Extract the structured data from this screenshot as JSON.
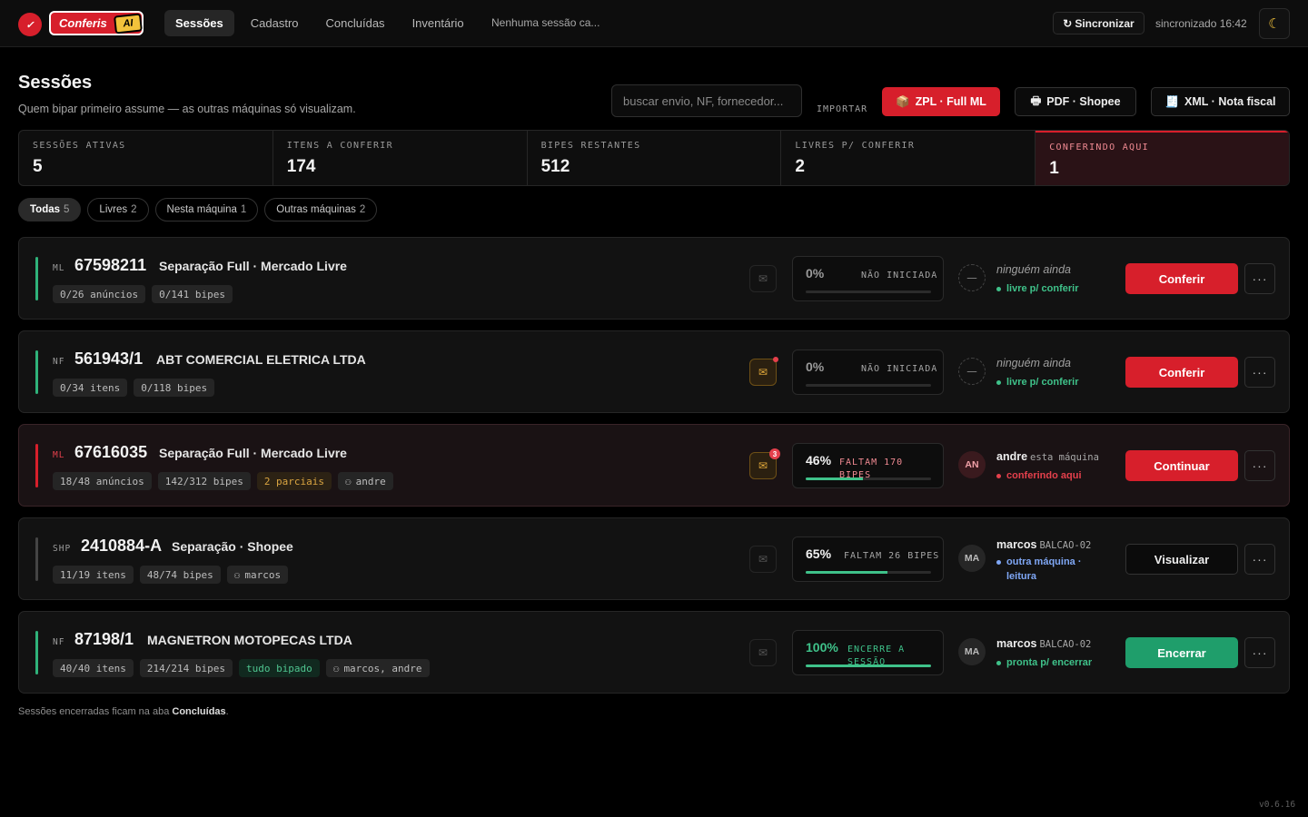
{
  "app": {
    "logo_text": "Conferis",
    "logo_badge": "AI",
    "version": "v0.6.16"
  },
  "nav": {
    "tabs": [
      "Sessões",
      "Cadastro",
      "Concluídas",
      "Inventário"
    ],
    "active": "Sessões",
    "session_status": "Nenhuma sessão ca..."
  },
  "sync": {
    "button_label": "Sincronizar",
    "status": "sincronizado 16:42"
  },
  "header": {
    "title": "Sessões",
    "subtitle": "Quem bipar primeiro assume — as outras máquinas só visualizam.",
    "search_placeholder": "buscar envio, NF, fornecedor...",
    "import_label": "IMPORTAR",
    "buttons": {
      "zpl": "ZPL · Full ML",
      "pdf": "PDF · Shopee",
      "xml": "XML · Nota fiscal"
    }
  },
  "stats": [
    {
      "label": "SESSÕES ATIVAS",
      "value": "5"
    },
    {
      "label": "ITENS A CONFERIR",
      "value": "174"
    },
    {
      "label": "BIPES RESTANTES",
      "value": "512"
    },
    {
      "label": "LIVRES P/ CONFERIR",
      "value": "2"
    },
    {
      "label": "CONFERINDO AQUI",
      "value": "1"
    }
  ],
  "filters": [
    {
      "label": "Todas",
      "count": "5"
    },
    {
      "label": "Livres",
      "count": "2"
    },
    {
      "label": "Nesta máquina",
      "count": "1"
    },
    {
      "label": "Outras máquinas",
      "count": "2"
    }
  ],
  "sessions": [
    {
      "type": "ML",
      "id": "67598211",
      "desc": "Separação Full · Mercado Livre",
      "tags": [
        "0/26 anúncios",
        "0/141 bipes"
      ],
      "pct": "0%",
      "pct_value": 0,
      "state": "NÃO INICIADA",
      "avatar": "—",
      "who": "ninguém ainda",
      "machine": "",
      "status": "livre p/ conferir",
      "action": "Conferir",
      "more": "···",
      "bar_color": "#2fb27a",
      "status_color": "#3fc28a"
    },
    {
      "type": "NF",
      "id": "561943/1",
      "desc": "ABT COMERCIAL ELETRICA LTDA",
      "tags": [
        "0/34 itens",
        "0/118 bipes"
      ],
      "pct": "0%",
      "pct_value": 0,
      "state": "NÃO INICIADA",
      "avatar": "—",
      "who": "ninguém ainda",
      "machine": "",
      "status": "livre p/ conferir",
      "action": "Conferir",
      "more": "···",
      "bar_color": "#2fb27a",
      "status_color": "#3fc28a"
    },
    {
      "type": "ML",
      "id": "67616035",
      "desc": "Separação Full · Mercado Livre",
      "tags": [
        "18/48 anúncios",
        "142/312 bipes",
        "2 parciais",
        "andre"
      ],
      "inbox_badge": "3",
      "pct": "46%",
      "pct_value": 46,
      "state": "FALTAM 170 BIPES",
      "avatar": "AN",
      "who": "andre",
      "machine": "esta máquina",
      "status": "conferindo aqui",
      "action": "Continuar",
      "more": "···",
      "bar_color": "#d71f2b",
      "status_color": "#e5404c"
    },
    {
      "type": "SHP",
      "id": "2410884-A",
      "desc": "Separação · Shopee",
      "tags": [
        "11/19 itens",
        "48/74 bipes",
        "marcos"
      ],
      "pct": "65%",
      "pct_value": 65,
      "state": "FALTAM 26 BIPES",
      "avatar": "MA",
      "who": "marcos",
      "machine": "BALCAO-02",
      "status": "outra máquina · leitura",
      "action": "Visualizar",
      "more": "···",
      "bar_color": "#444444",
      "status_color": "#7fa7f5"
    },
    {
      "type": "NF",
      "id": "87198/1",
      "desc": "MAGNETRON MOTOPECAS LTDA",
      "tags": [
        "40/40 itens",
        "214/214 bipes",
        "tudo bipado",
        "marcos, andre"
      ],
      "pct": "100%",
      "pct_value": 100,
      "state": "ENCERRE A SESSÃO",
      "avatar": "MA",
      "who": "marcos",
      "machine": "BALCAO-02",
      "status": "pronta p/ encerrar",
      "action": "Encerrar",
      "more": "···",
      "bar_color": "#2fb27a",
      "status_color": "#3fc28a"
    }
  ],
  "footer": {
    "text_before": "Sessões encerradas ficam na aba ",
    "link": "Concluídas",
    "text_after": "."
  }
}
